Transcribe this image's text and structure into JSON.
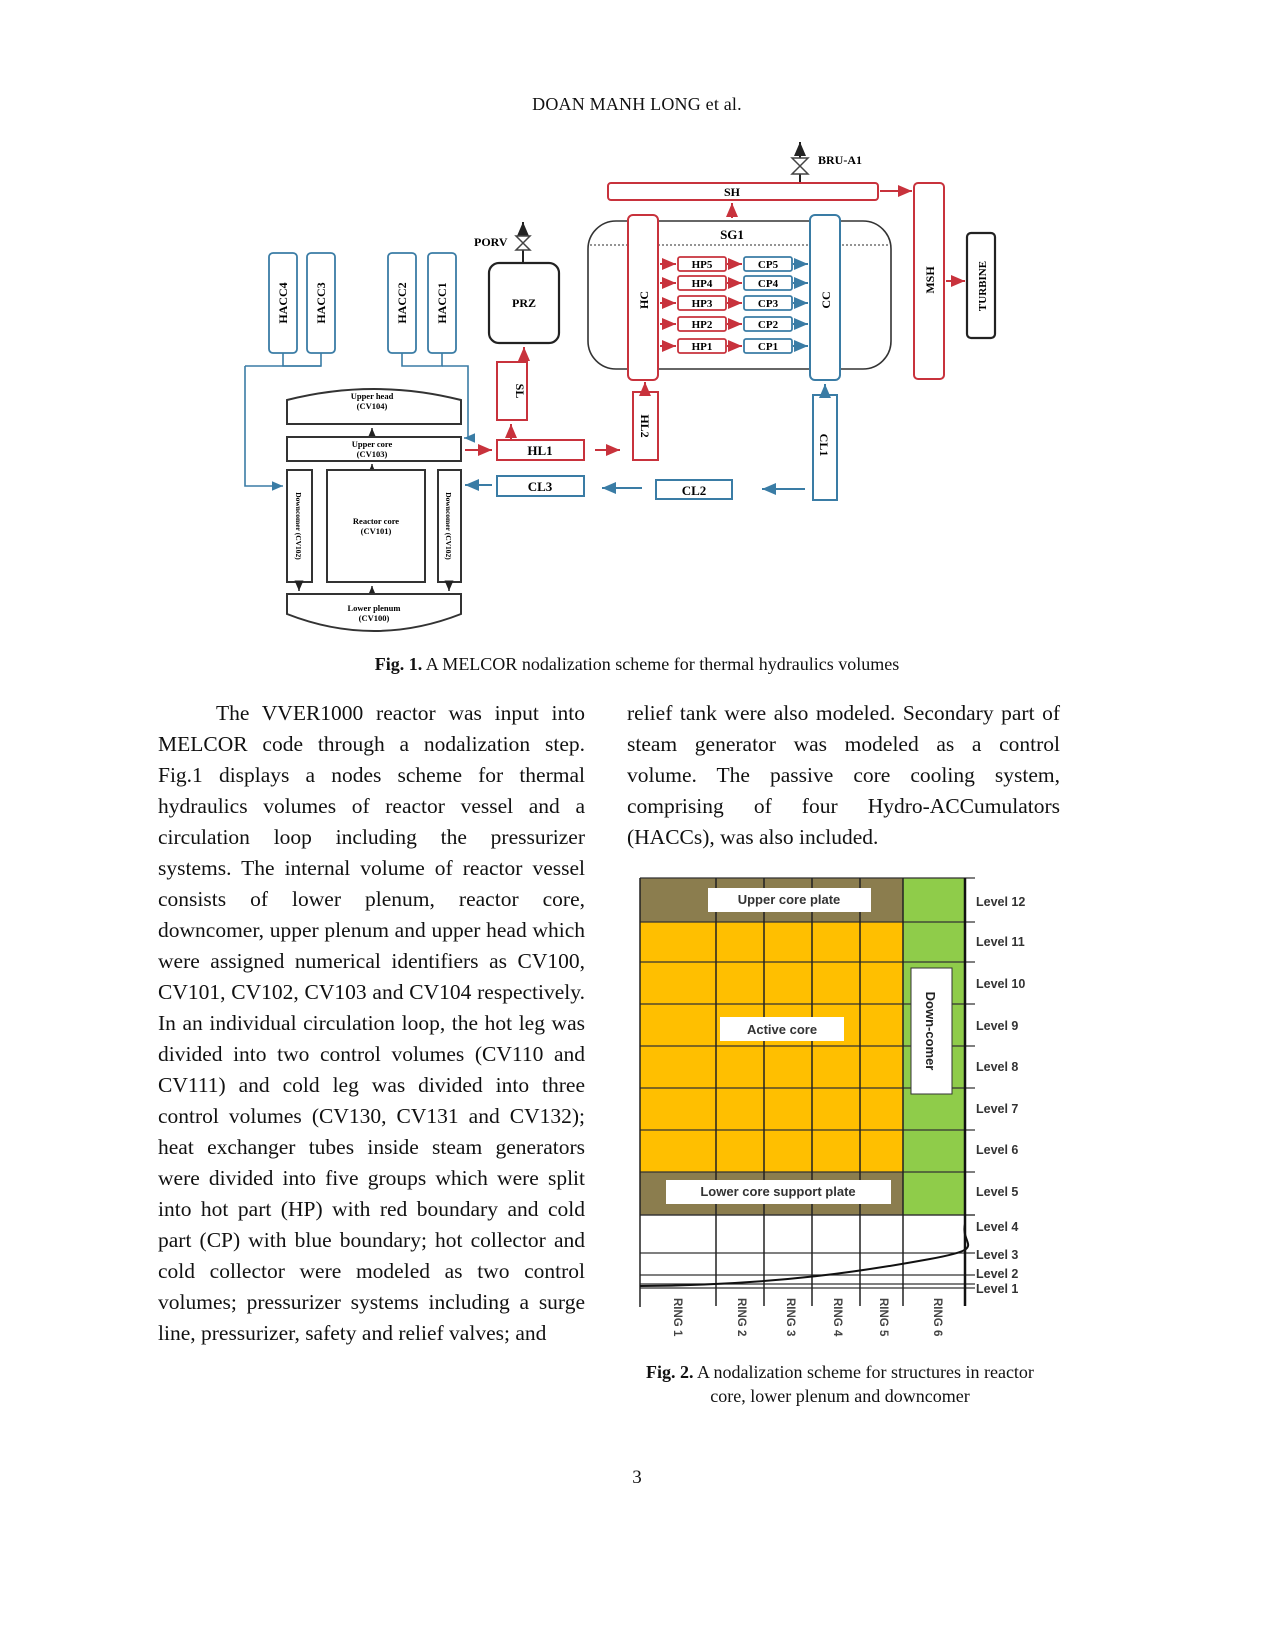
{
  "running_head": "DOAN MANH LONG et al.",
  "figure1": {
    "caption_label": "Fig. 1.",
    "caption_text": " A MELCOR nodalization scheme for thermal hydraulics volumes",
    "labels": {
      "bru": "BRU-A1",
      "sh": "SH",
      "sg": "SG1",
      "porv": "PORV",
      "prz": "PRZ",
      "hc": "HC",
      "cc": "CC",
      "msh": "MSH",
      "turbine": "TURBINE",
      "hp": [
        "HP5",
        "HP4",
        "HP3",
        "HP2",
        "HP1"
      ],
      "cp": [
        "CP5",
        "CP4",
        "CP3",
        "CP2",
        "CP1"
      ],
      "hacc4": "HACC4",
      "hacc3": "HACC3",
      "hacc2": "HACC2",
      "hacc1": "HACC1",
      "upper_head": "Upper head",
      "upper_head_cv": "(CV104)",
      "upper_core": "Upper core",
      "upper_core_cv": "(CV103)",
      "reactor_core": "Reactor core",
      "reactor_core_cv": "(CV101)",
      "downcomer_left": "Downcomer (CV102)",
      "downcomer_right": "Downcomer (CV102)",
      "lower_plenum": "Lower plenum",
      "lower_plenum_cv": "(CV100)",
      "sl": "SL",
      "hl1": "HL1",
      "hl2": "HL2",
      "cl1": "CL1",
      "cl2": "CL2",
      "cl3": "CL3"
    },
    "colors": {
      "hot": "#c8323c",
      "cold": "#3a7ca5",
      "neutral": "#222222"
    }
  },
  "left_column": [
    "The VVER1000 reactor was input into MELCOR code through a nodalization step. Fig.1 displays a nodes scheme for thermal hydraulics volumes of reactor vessel and a circulation loop including the pressurizer systems. The internal volume of reactor vessel consists of lower plenum, reactor core, downcomer, upper plenum and upper head which were assigned numerical identifiers as CV100, CV101, CV102, CV103 and CV104 respectively. In an individual circulation loop, the hot leg was divided into two control volumes (CV110 and CV111) and cold leg was divided into three control volumes (CV130, CV131 and CV132); heat exchanger tubes inside steam generators were divided into five groups which were split into hot part (HP) with red boundary and cold part (CP) with blue boundary; hot collector and cold collector were modeled as two control volumes; pressurizer systems including a surge line, pressurizer, safety and relief valves; and"
  ],
  "right_column": [
    "relief tank were also modeled. Secondary part of steam generator was modeled as a control volume. The passive core cooling system, comprising of four Hydro-ACCumulators (HACCs), was also included."
  ],
  "figure2": {
    "caption_label": "Fig. 2.",
    "caption_text": " A nodalization scheme for structures in reactor core, lower plenum and downcomer",
    "upper_plate": "Upper core plate",
    "active_core": "Active core",
    "lower_plate": "Lower core support plate",
    "downcomer": "Down-comer",
    "levels": [
      "Level 12",
      "Level 11",
      "Level 10",
      "Level 9",
      "Level 8",
      "Level 7",
      "Level 6",
      "Level 5",
      "Level 4",
      "Level 3",
      "Level 2",
      "Level 1"
    ],
    "rings": [
      "RING 1",
      "RING 2",
      "RING 3",
      "RING 4",
      "RING 5",
      "RING 6"
    ],
    "colors": {
      "plate": "#8b7d4e",
      "core": "#ffbf00",
      "downcomer": "#8fcc4a"
    }
  },
  "page_number": "3"
}
